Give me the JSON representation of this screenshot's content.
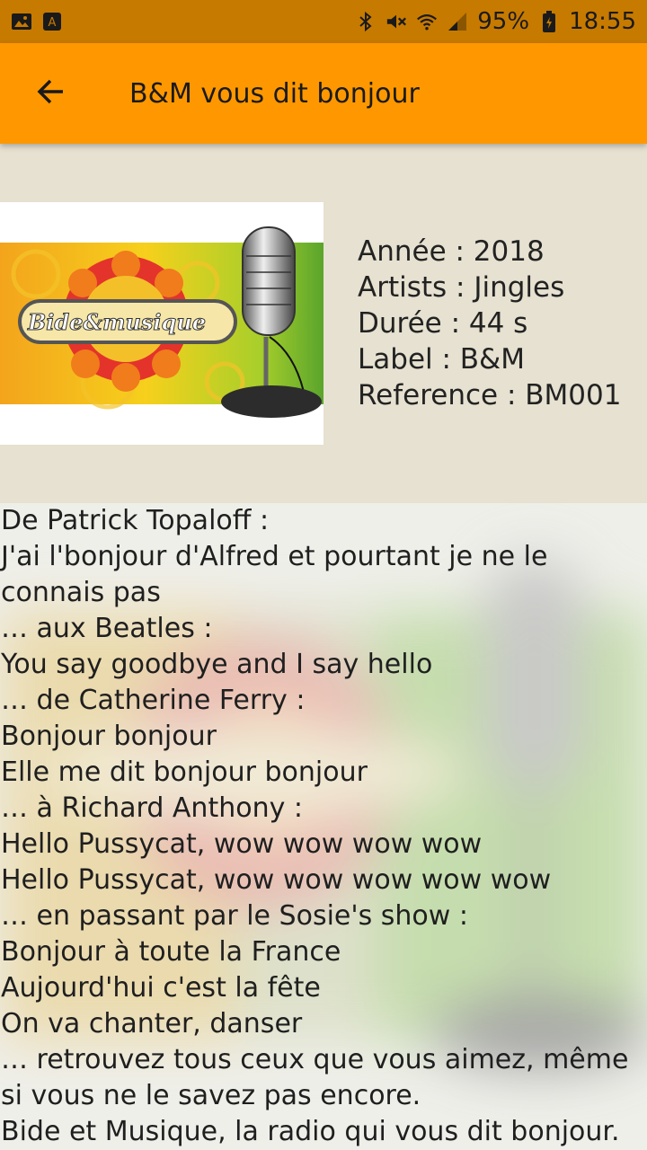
{
  "status_bar": {
    "battery": "95%",
    "time": "18:55",
    "left_icons": [
      "image-icon",
      "a-badge-icon"
    ],
    "right_icons": [
      "bluetooth-icon",
      "mute-icon",
      "wifi-icon",
      "signal-icon",
      "battery-icon"
    ]
  },
  "app_bar": {
    "title": "B&M vous dit bonjour",
    "back_icon": "arrow-left-icon",
    "color": "#ff9800"
  },
  "cover": {
    "logo_text": "Bide&musique"
  },
  "info": {
    "year": "Année : 2018",
    "artists": "Artists : Jingles",
    "duration": "Durée : 44 s",
    "label": "Label : B&M",
    "reference": "Reference : BM001"
  },
  "lyrics": {
    "text": "De Patrick Topaloff :\n J'ai l'bonjour d'Alfred et pourtant je ne le connais pas\n… aux Beatles :\nYou say goodbye and I say hello\n… de Catherine Ferry :\nBonjour bonjour\nElle me dit bonjour bonjour\n… à Richard Anthony :\nHello Pussycat, wow wow wow wow\nHello Pussycat, wow wow wow wow wow\n… en passant par le Sosie's show :\nBonjour à toute la France\nAujourd'hui c'est la fête\nOn va chanter, danser\n… retrouvez tous ceux que vous aimez, même si vous ne le savez pas encore.\nBide et Musique, la radio qui vous dit bonjour."
  }
}
